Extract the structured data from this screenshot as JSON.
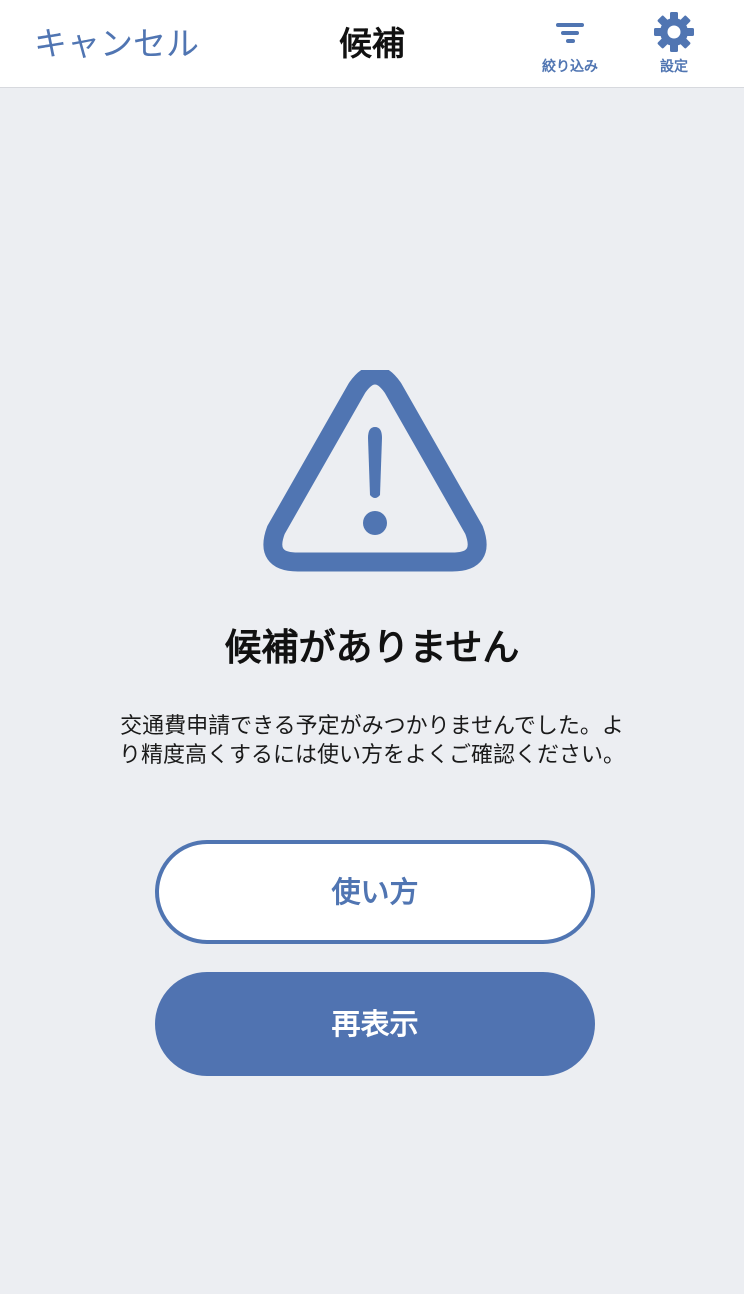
{
  "header": {
    "cancel_label": "キャンセル",
    "title": "候補",
    "filter": {
      "label": "絞り込み",
      "icon": "filter-icon"
    },
    "settings": {
      "label": "設定",
      "icon": "gear-icon"
    }
  },
  "empty_state": {
    "icon": "warning-triangle-icon",
    "title": "候補がありません",
    "message": "交通費申請できる予定がみつかりませんでした。より精度高くするには使い方をよくご確認ください。"
  },
  "buttons": {
    "howto_label": "使い方",
    "reload_label": "再表示"
  },
  "colors": {
    "accent": "#5075b2",
    "background": "#eceef2",
    "header_bg": "#ffffff"
  }
}
